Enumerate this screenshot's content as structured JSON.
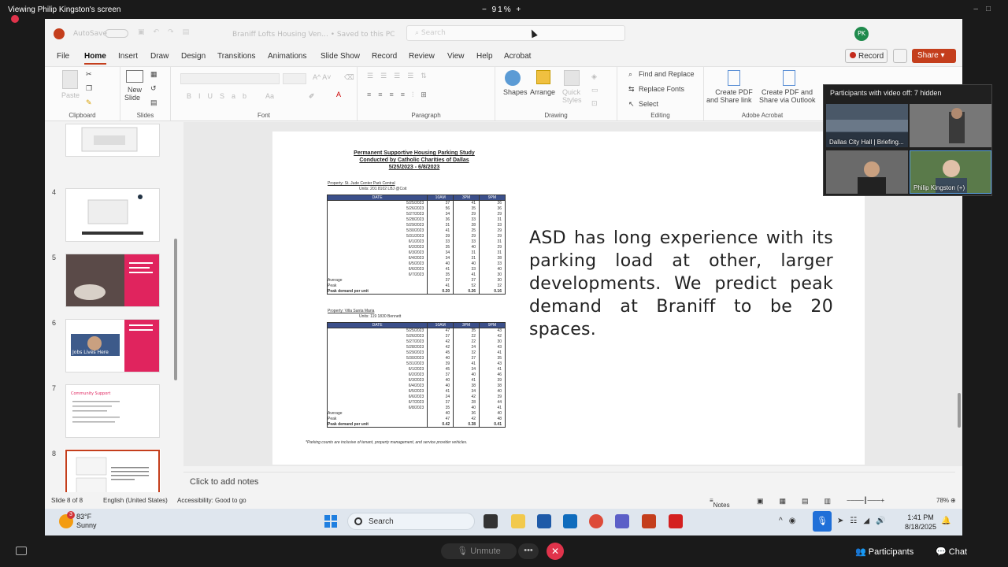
{
  "meeting": {
    "viewing_label": "Viewing Philip Kingston's screen",
    "zoom_display": "91%",
    "zoom_minus": "−",
    "zoom_plus": "+",
    "unmute_label": "Unmute",
    "more_label": "•••",
    "leave_label": "✕",
    "participants_label": "Participants",
    "chat_label": "Chat",
    "pip_header": "Participants with video off: 7 hidden",
    "tiles": [
      {
        "name": "Dallas City Hall",
        "sub": "Briefing..."
      },
      {
        "name": ""
      },
      {
        "name": ""
      },
      {
        "name": "Philip Kingston (+)"
      }
    ]
  },
  "app": {
    "autosave_label": "AutoSave",
    "toggle_label": "Off",
    "doc_name": "Braniff Lofts Housing Ven... • Saved to this PC",
    "search_placeholder": "Search",
    "user_initials": "PK",
    "menu_tabs": [
      "File",
      "Home",
      "Insert",
      "Draw",
      "Design",
      "Transitions",
      "Animations",
      "Slide Show",
      "Record",
      "Review",
      "View",
      "Help",
      "Acrobat"
    ],
    "active_tab": "Home",
    "record_btn": "Record",
    "share_btn": "Share"
  },
  "ribbon": {
    "clipboard": {
      "label": "Clipboard",
      "paste": "Paste"
    },
    "slides": {
      "label": "Slides",
      "new_slide": "New",
      "new_slide2": "Slide"
    },
    "font": {
      "label": "Font"
    },
    "paragraph": {
      "label": "Paragraph"
    },
    "drawing": {
      "label": "Drawing",
      "shapes": "Shapes",
      "arrange": "Arrange",
      "quick_styles": "Quick",
      "quick_styles2": "Styles"
    },
    "editing": {
      "label": "Editing",
      "find": "Find and Replace",
      "replace": "Replace Fonts",
      "select": "Select"
    },
    "acrobat": {
      "label": "Adobe Acrobat",
      "create_pdf": "Create PDF",
      "create_pdf2": "and Share link",
      "create_pdf_outlook": "Create PDF and",
      "create_pdf_outlook2": "Share via Outlook"
    }
  },
  "thumbnails": [
    {
      "num": "4"
    },
    {
      "num": "5"
    },
    {
      "num": "6",
      "caption": "Jobs Lives Here"
    },
    {
      "num": "7",
      "title": "Community Support"
    },
    {
      "num": "8"
    }
  ],
  "slide": {
    "title_line1": "Permanent Supportive Housing Parking Study",
    "title_line2": "Conducted by Catholic Charities of Dallas",
    "title_line3": "5/25/2023 - 6/8/2023",
    "property1": "Property: St. Jude Center Park Central",
    "property1_units": "Units: 201          8102 LBJ @Coit",
    "property2": "Property: Villa Santa Maria",
    "property2_units": "Units: 119          1830 Bennett",
    "table_headers": [
      "DATE",
      "10AM",
      "3PM",
      "9PM"
    ],
    "table1": [
      [
        "5/25/2023",
        "37",
        "41",
        "26"
      ],
      [
        "5/26/2023",
        "56",
        "35",
        "36"
      ],
      [
        "5/27/2023",
        "34",
        "29",
        "29"
      ],
      [
        "5/28/2023",
        "36",
        "33",
        "31"
      ],
      [
        "5/29/2023",
        "31",
        "28",
        "33"
      ],
      [
        "5/30/2023",
        "41",
        "25",
        "29"
      ],
      [
        "5/31/2023",
        "39",
        "29",
        "29"
      ],
      [
        "6/1/2023",
        "33",
        "33",
        "31"
      ],
      [
        "6/2/2023",
        "35",
        "40",
        "29"
      ],
      [
        "6/3/2023",
        "34",
        "31",
        "31"
      ],
      [
        "6/4/2023",
        "34",
        "31",
        "28"
      ],
      [
        "6/5/2023",
        "40",
        "40",
        "33"
      ],
      [
        "6/6/2023",
        "41",
        "33",
        "40"
      ],
      [
        "6/7/2023",
        "35",
        "41",
        "30"
      ]
    ],
    "table1_summary": [
      [
        "Average",
        "37",
        "37",
        "30"
      ],
      [
        "Peak",
        "41",
        "52",
        "32"
      ],
      [
        "Peak demand per unit",
        "0.20",
        "0.26",
        "0.16"
      ]
    ],
    "table2": [
      [
        "5/25/2023",
        "47",
        "35",
        "43"
      ],
      [
        "5/26/2023",
        "37",
        "22",
        "42"
      ],
      [
        "5/27/2023",
        "42",
        "22",
        "30"
      ],
      [
        "5/28/2023",
        "42",
        "24",
        "43"
      ],
      [
        "5/29/2023",
        "45",
        "32",
        "41"
      ],
      [
        "5/30/2023",
        "40",
        "37",
        "35"
      ],
      [
        "5/31/2023",
        "39",
        "41",
        "43"
      ],
      [
        "6/1/2023",
        "45",
        "34",
        "41"
      ],
      [
        "6/2/2023",
        "37",
        "40",
        "46"
      ],
      [
        "6/3/2023",
        "40",
        "41",
        "39"
      ],
      [
        "6/4/2023",
        "40",
        "38",
        "38"
      ],
      [
        "6/5/2023",
        "41",
        "34",
        "40"
      ],
      [
        "6/6/2023",
        "24",
        "42",
        "39"
      ],
      [
        "6/7/2023",
        "37",
        "28",
        "44"
      ],
      [
        "6/8/2023",
        "35",
        "40",
        "41"
      ]
    ],
    "table2_summary": [
      [
        "Average",
        "40",
        "36",
        "40"
      ],
      [
        "Peak",
        "47",
        "42",
        "48"
      ],
      [
        "Peak demand per unit",
        "0.42",
        "0.38",
        "0.41"
      ]
    ],
    "footnote": "*Parking counts are inclusive of tenant, property management, and service provider vehicles.",
    "body_text": "ASD has long experience with its parking load at other, larger developments. We predict peak demand at Braniff to be 20 spaces."
  },
  "notes_placeholder": "Click to add notes",
  "status": {
    "slide_of": "Slide 8 of 8",
    "language": "English (United States)",
    "accessibility": "Accessibility: Good to go",
    "notes_btn": "Notes",
    "zoom": "78%"
  },
  "taskbar": {
    "temp": "83°F",
    "condition": "Sunny",
    "badge": "3",
    "search": "Search",
    "time": "1:41 PM",
    "date": "8/18/2025"
  }
}
